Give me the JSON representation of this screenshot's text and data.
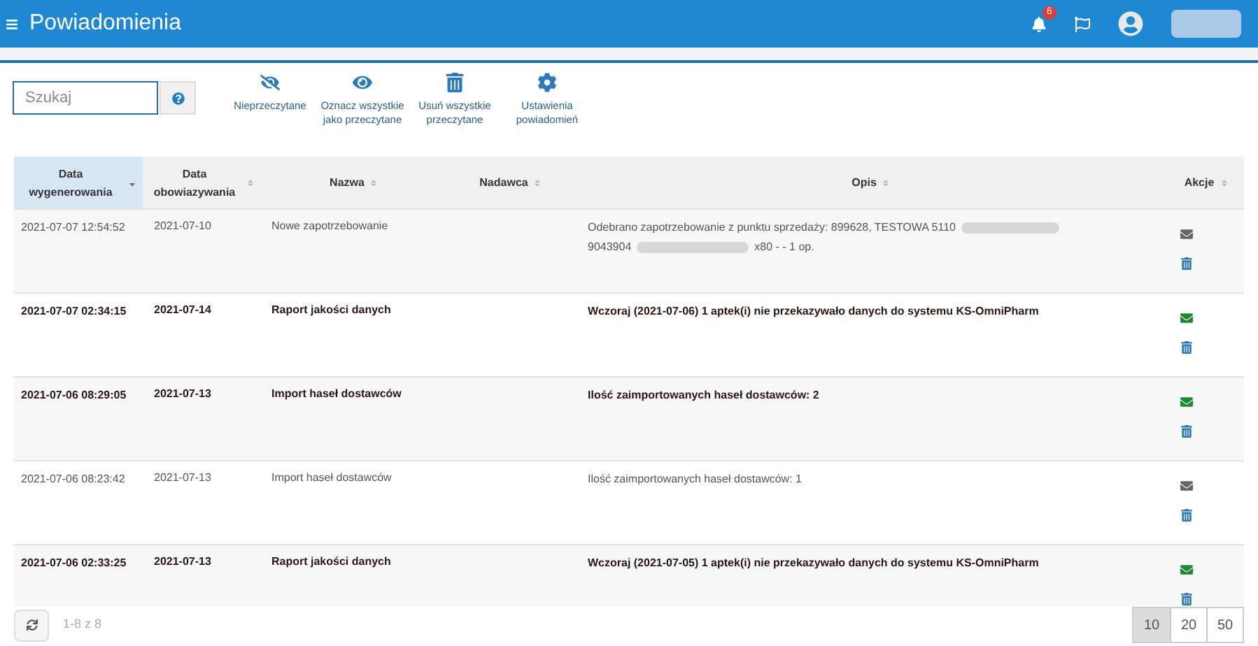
{
  "header": {
    "title": "Powiadomienia",
    "notification_count": "6"
  },
  "search": {
    "placeholder": "Szukaj"
  },
  "toolbar": [
    {
      "kind": "eye-slash",
      "label": "Nieprzeczytane"
    },
    {
      "kind": "eye",
      "label": "Oznacz wszystkie jako przeczytane"
    },
    {
      "kind": "trash",
      "label": "Usuń wszystkie przeczytane"
    },
    {
      "kind": "gear",
      "label": "Ustawienia powiadomień"
    }
  ],
  "table": {
    "columns": [
      {
        "label": "Data wygenerowania",
        "selected": true
      },
      {
        "label": "Data obowiazywania",
        "selected": false
      },
      {
        "label": "Nazwa",
        "selected": false
      },
      {
        "label": "Nadawca",
        "selected": false
      },
      {
        "label": "Opis",
        "selected": false
      },
      {
        "label": "Akcje",
        "selected": false
      }
    ],
    "rows": [
      {
        "unread": false,
        "generated": "2021-07-07 12:54:52",
        "valid": "2021-07-10",
        "name": "Nowe zapotrzebowanie",
        "sender": "",
        "description": [
          "Odebrano zapotrzebowanie z punktu sprzedaży: 899628, TESTOWA 5110",
          "9043904",
          "x80 - - 1 op."
        ]
      },
      {
        "unread": true,
        "generated": "2021-07-07 02:34:15",
        "valid": "2021-07-14",
        "name": "Raport jakości danych",
        "description": [
          "Wczoraj (2021-07-06) 1 aptek(i) nie przekazywało danych do systemu KS-OmniPharm"
        ]
      },
      {
        "unread": true,
        "generated": "2021-07-06 08:29:05",
        "valid": "2021-07-13",
        "name": "Import haseł dostawców",
        "description": [
          "Ilość zaimportowanych haseł dostawców: 2"
        ]
      },
      {
        "unread": false,
        "generated": "2021-07-06 08:23:42",
        "valid": "2021-07-13",
        "name": "Import haseł dostawców",
        "description": [
          "Ilość zaimportowanych haseł dostawców: 1"
        ]
      },
      {
        "unread": true,
        "generated": "2021-07-06 02:33:25",
        "valid": "2021-07-13",
        "name": "Raport jakości danych",
        "description": [
          "Wczoraj (2021-07-05) 1 aptek(i) nie przekazywało danych do systemu KS-OmniPharm"
        ]
      }
    ]
  },
  "footer": {
    "range": "1-8 z 8",
    "page_sizes": [
      {
        "label": "10",
        "selected": true
      },
      {
        "label": "20",
        "selected": false
      },
      {
        "label": "50",
        "selected": false
      }
    ]
  }
}
